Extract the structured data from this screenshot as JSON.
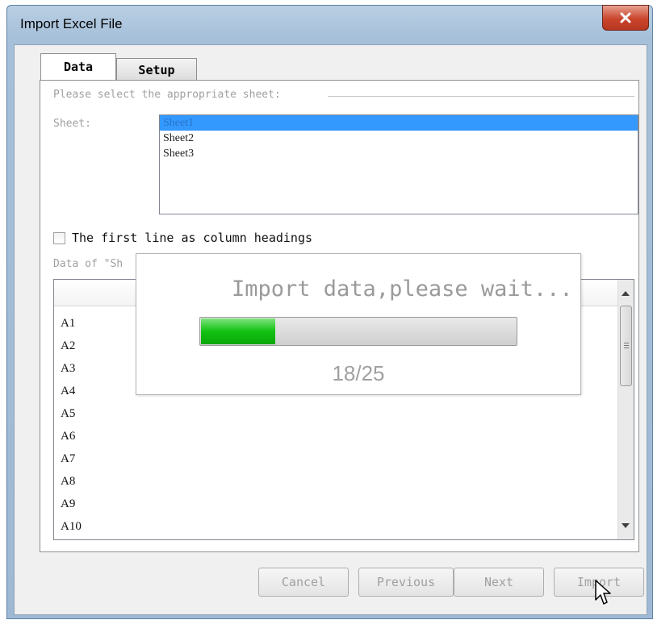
{
  "window": {
    "title": "Import Excel File",
    "close_icon": "close-x-icon"
  },
  "tabs": [
    {
      "label": "Data",
      "active": true
    },
    {
      "label": "Setup",
      "active": false
    }
  ],
  "sheet_section": {
    "group_label": "Please select the appropriate sheet:",
    "sheet_label": "Sheet:",
    "sheets": [
      "Sheet1",
      "Sheet2",
      "Sheet3"
    ],
    "selected": "Sheet1"
  },
  "checkbox": {
    "label": "The first line as column headings",
    "checked": false
  },
  "data_section": {
    "label": "Data of \"Sh",
    "rows": [
      "A1",
      "A2",
      "A3",
      "A4",
      "A5",
      "A6",
      "A7",
      "A8",
      "A9",
      "A10"
    ]
  },
  "progress": {
    "message": "Import data,please wait...",
    "count_text": "18/25",
    "fraction": 0.24,
    "fill_color": "#12c112"
  },
  "buttons": {
    "cancel": "Cancel",
    "previous": "Previous",
    "next": "Next",
    "import": "Import"
  },
  "colors": {
    "selection": "#3399ff",
    "titlebar": "#a6c0da",
    "close": "#c9452c"
  }
}
